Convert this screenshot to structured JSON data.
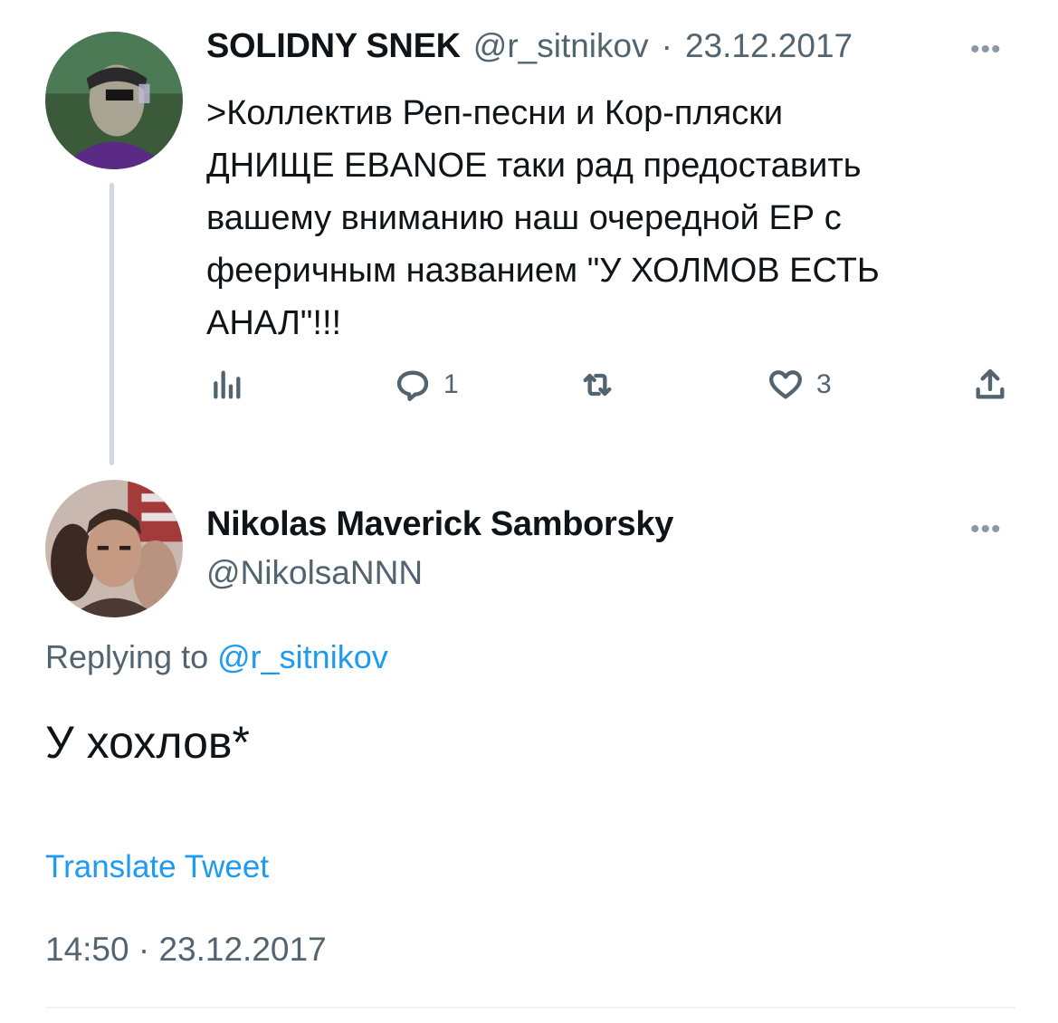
{
  "parent_tweet": {
    "display_name": "SOLIDNY SNEK",
    "handle": "@r_sitnikov",
    "separator": "·",
    "date": "23.12.2017",
    "more": "•••",
    "text": ">Коллектив Реп-песни и Кор-пляски\nДНИЩЕ EBANOE таки рад предоставить\nвашему вниманию наш очередной ЕР с\nфееричным названием \"У ХОЛМОВ ЕСТЬ\nАНАЛ\"!!!",
    "actions": {
      "views_icon": "bar-chart-icon",
      "replies_icon": "reply-bubble-icon",
      "replies_count": "1",
      "retweets_icon": "retweet-icon",
      "likes_icon": "heart-icon",
      "likes_count": "3",
      "share_icon": "share-icon"
    }
  },
  "reply_tweet": {
    "display_name": "Nikolas Maverick Samborsky",
    "handle": "@NikolsaNNN",
    "more": "•••",
    "replying_prefix": "Replying to",
    "replying_handle": "@r_sitnikov",
    "text": "У хохлов*",
    "translate": "Translate Tweet",
    "timestamp": "14:50 · 23.12.2017"
  },
  "colors": {
    "text": "#0f1419",
    "muted": "#536471",
    "link": "#1d9bf0",
    "thread_line": "#cfd9de",
    "divider": "#eff3f4"
  }
}
